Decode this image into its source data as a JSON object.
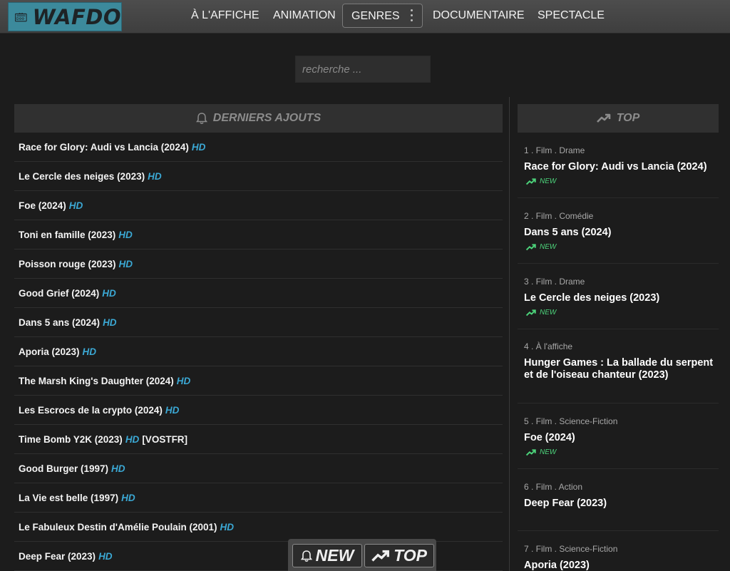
{
  "brand": {
    "name": "WAFDO"
  },
  "nav": {
    "items": [
      "À L'AFFICHE",
      "ANIMATION",
      "DOCUMENTAIRE",
      "SPECTACLE"
    ],
    "genres_label": "GENRES"
  },
  "search": {
    "placeholder": "recherche ..."
  },
  "latest": {
    "title": "DERNIERS AJOUTS",
    "items": [
      {
        "title": "Race for Glory: Audi vs Lancia (2024)",
        "quality": "HD",
        "extra": ""
      },
      {
        "title": "Le Cercle des neiges (2023)",
        "quality": "HD",
        "extra": ""
      },
      {
        "title": "Foe (2024)",
        "quality": "HD",
        "extra": ""
      },
      {
        "title": "Toni en famille (2023)",
        "quality": "HD",
        "extra": ""
      },
      {
        "title": "Poisson rouge (2023)",
        "quality": "HD",
        "extra": ""
      },
      {
        "title": "Good Grief (2024)",
        "quality": "HD",
        "extra": ""
      },
      {
        "title": "Dans 5 ans (2024)",
        "quality": "HD",
        "extra": ""
      },
      {
        "title": "Aporia (2023)",
        "quality": "HD",
        "extra": ""
      },
      {
        "title": "The Marsh King's Daughter (2024)",
        "quality": "HD",
        "extra": ""
      },
      {
        "title": "Les Escrocs de la crypto (2024)",
        "quality": "HD",
        "extra": ""
      },
      {
        "title": "Time Bomb Y2K (2023)",
        "quality": "HD",
        "extra": "[VOSTFR]"
      },
      {
        "title": "Good Burger (1997)",
        "quality": "HD",
        "extra": ""
      },
      {
        "title": "La Vie est belle (1997)",
        "quality": "HD",
        "extra": ""
      },
      {
        "title": "Le Fabuleux Destin d'Amélie Poulain (2001)",
        "quality": "HD",
        "extra": ""
      },
      {
        "title": "Deep Fear (2023)",
        "quality": "HD",
        "extra": ""
      }
    ]
  },
  "top": {
    "title": "TOP",
    "items": [
      {
        "meta": "1 . Film . Drame",
        "title": "Race for Glory: Audi vs Lancia (2024)",
        "badge": "NEW"
      },
      {
        "meta": "2 . Film . Comédie",
        "title": "Dans 5 ans (2024)",
        "badge": "NEW"
      },
      {
        "meta": "3 . Film . Drame",
        "title": "Le Cercle des neiges (2023)",
        "badge": "NEW"
      },
      {
        "meta": "4 . À l'affiche",
        "title": "Hunger Games : La ballade du serpent et de l'oiseau chanteur (2023)",
        "badge": ""
      },
      {
        "meta": "5 . Film . Science-Fiction",
        "title": "Foe (2024)",
        "badge": "NEW"
      },
      {
        "meta": "6 . Film . Action",
        "title": "Deep Fear (2023)",
        "badge": ""
      },
      {
        "meta": "7 . Film . Science-Fiction",
        "title": "Aporia (2023)",
        "badge": ""
      }
    ]
  },
  "floating": {
    "new_label": "NEW",
    "top_label": "TOP"
  },
  "colors": {
    "accent": "#3ba8d4",
    "new_badge": "#4cd27a",
    "logo_bg": "#3c8a9c"
  },
  "icons": {
    "logo": "tv-icon",
    "genres_menu": "vertical-dots-icon",
    "latest": "bell-icon",
    "top": "trending-up-icon"
  }
}
